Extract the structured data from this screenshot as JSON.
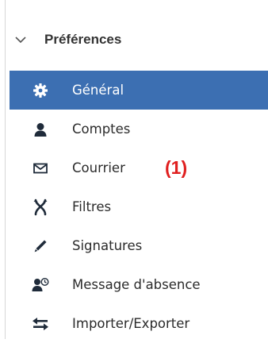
{
  "preferences": {
    "header_title": "Préférences",
    "items": [
      {
        "id": "general",
        "label": "Général",
        "icon": "gear-icon",
        "active": true
      },
      {
        "id": "comptes",
        "label": "Comptes",
        "icon": "user-icon",
        "active": false
      },
      {
        "id": "courrier",
        "label": "Courrier",
        "icon": "envelope-icon",
        "active": false
      },
      {
        "id": "filtres",
        "label": "Filtres",
        "icon": "filter-icon",
        "active": false
      },
      {
        "id": "signatures",
        "label": "Signatures",
        "icon": "pen-icon",
        "active": false
      },
      {
        "id": "absence",
        "label": "Message d'absence",
        "icon": "user-clock-icon",
        "active": false
      },
      {
        "id": "import-export",
        "label": "Importer/Exporter",
        "icon": "import-export-icon",
        "active": false
      }
    ]
  },
  "annotation": {
    "label": "(1)"
  },
  "colors": {
    "active_background": "#3c6fb2",
    "active_text": "#ffffff",
    "text": "#2b2b2b",
    "icon": "#1f2b3a",
    "annotation": "#e01f1f"
  }
}
